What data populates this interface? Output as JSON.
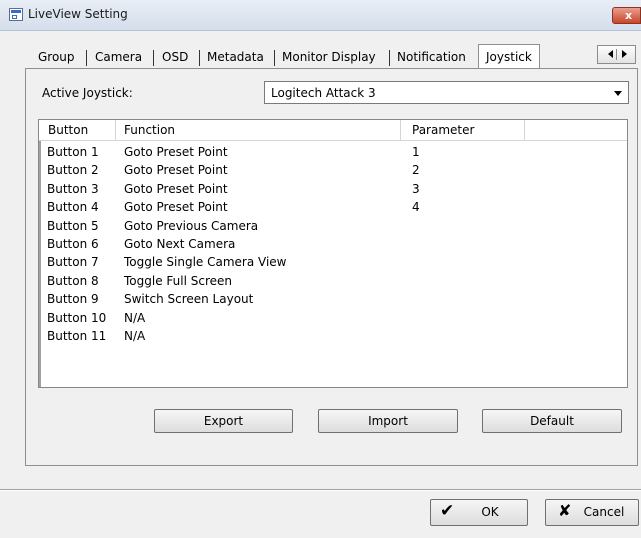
{
  "window": {
    "title": "LiveView Setting",
    "close_label": "x"
  },
  "tabs": [
    {
      "label": "Group"
    },
    {
      "label": "Camera"
    },
    {
      "label": "OSD"
    },
    {
      "label": "Metadata"
    },
    {
      "label": "Monitor Display"
    },
    {
      "label": "Notification"
    },
    {
      "label": "Joystick",
      "active": true
    }
  ],
  "joystick": {
    "label": "Active Joystick:",
    "selected": "Logitech Attack 3"
  },
  "table": {
    "columns": [
      "Button",
      "Function",
      "Parameter"
    ],
    "rows": [
      {
        "button": "Button 1",
        "function": "Goto Preset Point",
        "parameter": "1"
      },
      {
        "button": "Button 2",
        "function": "Goto Preset Point",
        "parameter": "2"
      },
      {
        "button": "Button 3",
        "function": "Goto Preset Point",
        "parameter": "3"
      },
      {
        "button": "Button 4",
        "function": "Goto Preset Point",
        "parameter": "4"
      },
      {
        "button": "Button 5",
        "function": "Goto Previous Camera",
        "parameter": ""
      },
      {
        "button": "Button 6",
        "function": "Goto Next Camera",
        "parameter": ""
      },
      {
        "button": "Button 7",
        "function": "Toggle Single Camera View",
        "parameter": ""
      },
      {
        "button": "Button 8",
        "function": "Toggle Full Screen",
        "parameter": ""
      },
      {
        "button": "Button 9",
        "function": "Switch Screen Layout",
        "parameter": ""
      },
      {
        "button": "Button 10",
        "function": "N/A",
        "parameter": ""
      },
      {
        "button": "Button 11",
        "function": "N/A",
        "parameter": ""
      }
    ]
  },
  "actions": {
    "export": "Export",
    "import": "Import",
    "default": "Default"
  },
  "footer": {
    "ok": "OK",
    "cancel": "Cancel"
  }
}
